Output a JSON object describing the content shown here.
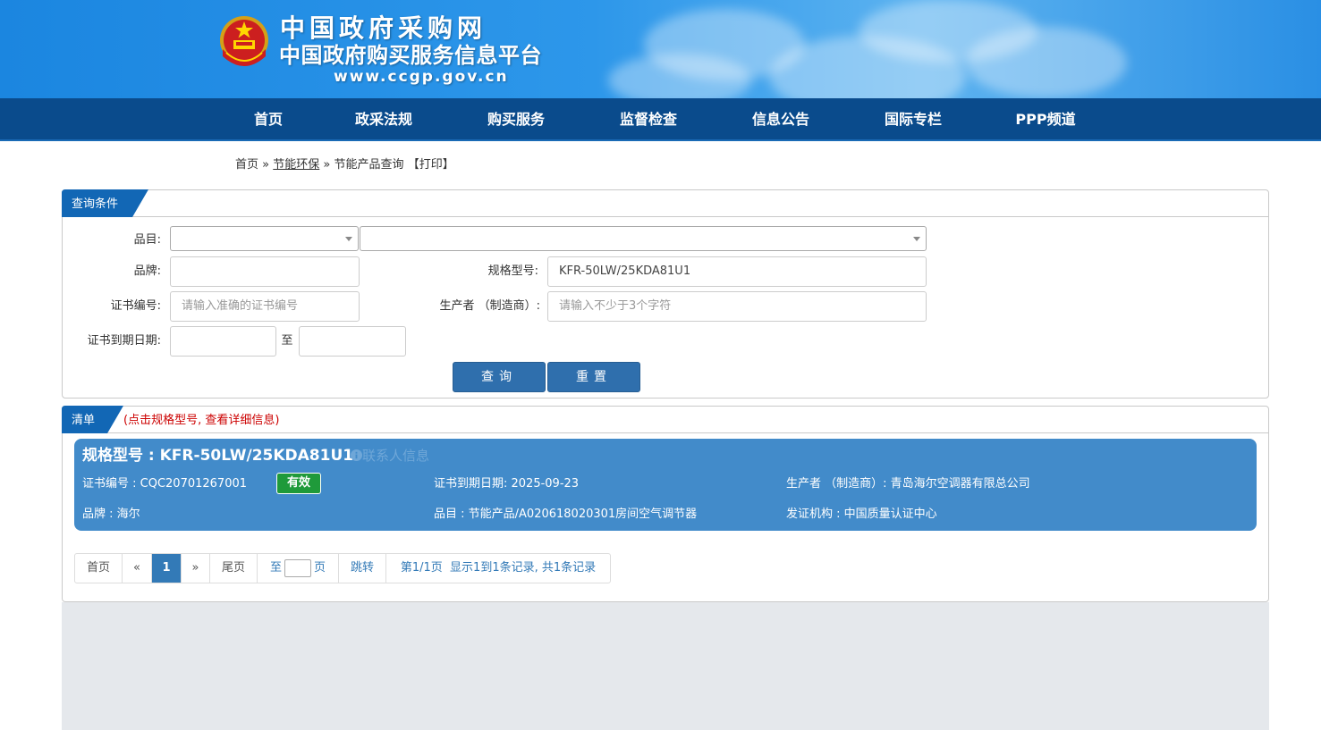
{
  "header": {
    "site_name": "中国政府采购网",
    "site_subtitle": "中国政府购买服务信息平台",
    "site_url": "www.ccgp.gov.cn"
  },
  "nav": [
    "首页",
    "政采法规",
    "购买服务",
    "监督检查",
    "信息公告",
    "国际专栏",
    "PPP频道"
  ],
  "breadcrumb": {
    "home": "首页",
    "sep1": "»",
    "section": "节能环保",
    "sep2": "»",
    "page": "节能产品查询",
    "print": "【打印】"
  },
  "query_panel": {
    "title": "查询条件",
    "category_label": "品目:",
    "brand_label": "品牌:",
    "brand_value": "",
    "model_label": "规格型号:",
    "model_value": "KFR-50LW/25KDA81U1",
    "cert_no_label": "证书编号:",
    "cert_no_placeholder": "请输入准确的证书编号",
    "manufacturer_label": "生产者 （制造商）:",
    "manufacturer_placeholder": "请输入不少于3个字符",
    "expiry_label": "证书到期日期:",
    "to_label": "至",
    "search_button": "查询",
    "reset_button": "重置"
  },
  "list_panel": {
    "title": "清单",
    "hint": "(点击规格型号, 查看详细信息)"
  },
  "result": {
    "model_title": "规格型号 : KFR-50LW/25KDA81U1",
    "contact_link": "联系人信息",
    "cert_no": "证书编号 : CQC20701267001",
    "status": "有效",
    "expiry": "证书到期日期: 2025-09-23",
    "manufacturer": "生产者 （制造商）: 青岛海尔空调器有限总公司",
    "brand": "品牌 : 海尔",
    "category": "品目 : 节能产品/A020618020301房间空气调节器",
    "issuer": "发证机构 : 中国质量认证中心"
  },
  "pagination": {
    "first": "首页",
    "prev": "«",
    "current": "1",
    "next": "»",
    "last": "尾页",
    "goto_prefix": "至",
    "goto_suffix": "页",
    "jump": "跳转",
    "summary": "第1/1页  显示1到1条记录, 共1条记录"
  },
  "colors": {
    "nav_bg": "#0a4b8c",
    "accent": "#1267b5",
    "card_bg": "#428bca",
    "valid_badge": "#1f9a3a",
    "hint_red": "#cc0000"
  }
}
